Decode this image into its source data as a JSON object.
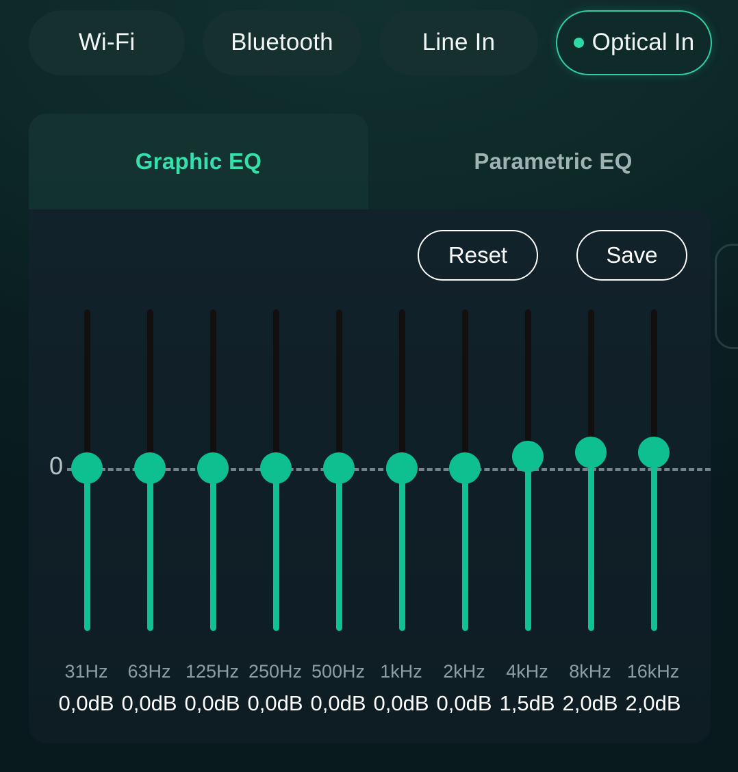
{
  "sources": {
    "items": [
      {
        "label": "Wi-Fi",
        "active": false
      },
      {
        "label": "Bluetooth",
        "active": false
      },
      {
        "label": "Line In",
        "active": false
      },
      {
        "label": "Optical In",
        "active": true
      }
    ]
  },
  "tabs": [
    {
      "label": "Graphic EQ",
      "active": true
    },
    {
      "label": "Parametric EQ",
      "active": false
    }
  ],
  "actions": {
    "reset_label": "Reset",
    "save_label": "Save"
  },
  "eq": {
    "zero_label": "0",
    "colors": {
      "accent": "#0ec08f",
      "accent_text": "#35e0ad",
      "track": "#130f0f",
      "zero_line": "#b2c2c4",
      "card": "#101f27",
      "background": "#0d2827"
    },
    "chart_data": {
      "type": "bar",
      "title": "Graphic EQ",
      "xlabel": "",
      "ylabel": "dB",
      "ylim": [
        -12,
        12
      ],
      "categories": [
        "31Hz",
        "63Hz",
        "125Hz",
        "250Hz",
        "500Hz",
        "1kHz",
        "2kHz",
        "4kHz",
        "8kHz",
        "16kHz"
      ],
      "values": [
        0.0,
        0.0,
        0.0,
        0.0,
        0.0,
        0.0,
        0.0,
        1.5,
        2.0,
        2.0
      ],
      "value_labels": [
        "0,0dB",
        "0,0dB",
        "0,0dB",
        "0,0dB",
        "0,0dB",
        "0,0dB",
        "0,0dB",
        "1,5dB",
        "2,0dB",
        "2,0dB"
      ],
      "grid": false,
      "legend": "none"
    }
  }
}
